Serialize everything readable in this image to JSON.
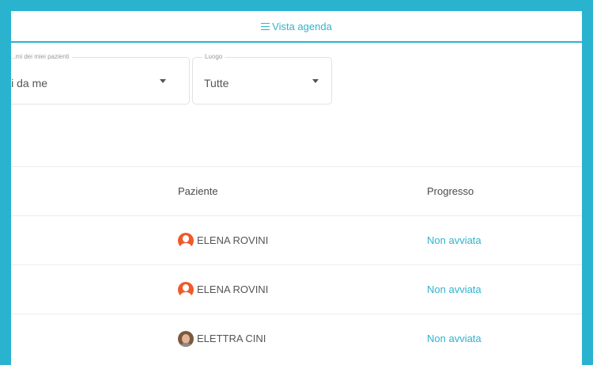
{
  "topbar": {
    "agenda_label": "Vista agenda",
    "agenda_icon": "menu-icon"
  },
  "filters": {
    "mine": {
      "label": "...mi dei miei pazienti",
      "value": "...nati da me"
    },
    "place": {
      "label": "Luogo",
      "value": "Tutte"
    }
  },
  "table": {
    "headers": {
      "patient": "Paziente",
      "progress": "Progresso"
    },
    "rows": [
      {
        "patient": "ELENA ROVINI",
        "avatar": "default-avatar-icon",
        "progress": "Non avviata"
      },
      {
        "patient": "ELENA ROVINI",
        "avatar": "default-avatar-icon",
        "progress": "Non avviata"
      },
      {
        "patient": "ELETTRA CINI",
        "avatar": "photo-avatar",
        "progress": "Non avviata"
      }
    ]
  },
  "colors": {
    "accent": "#29b3cf",
    "avatar_default": "#ef5a2c"
  }
}
